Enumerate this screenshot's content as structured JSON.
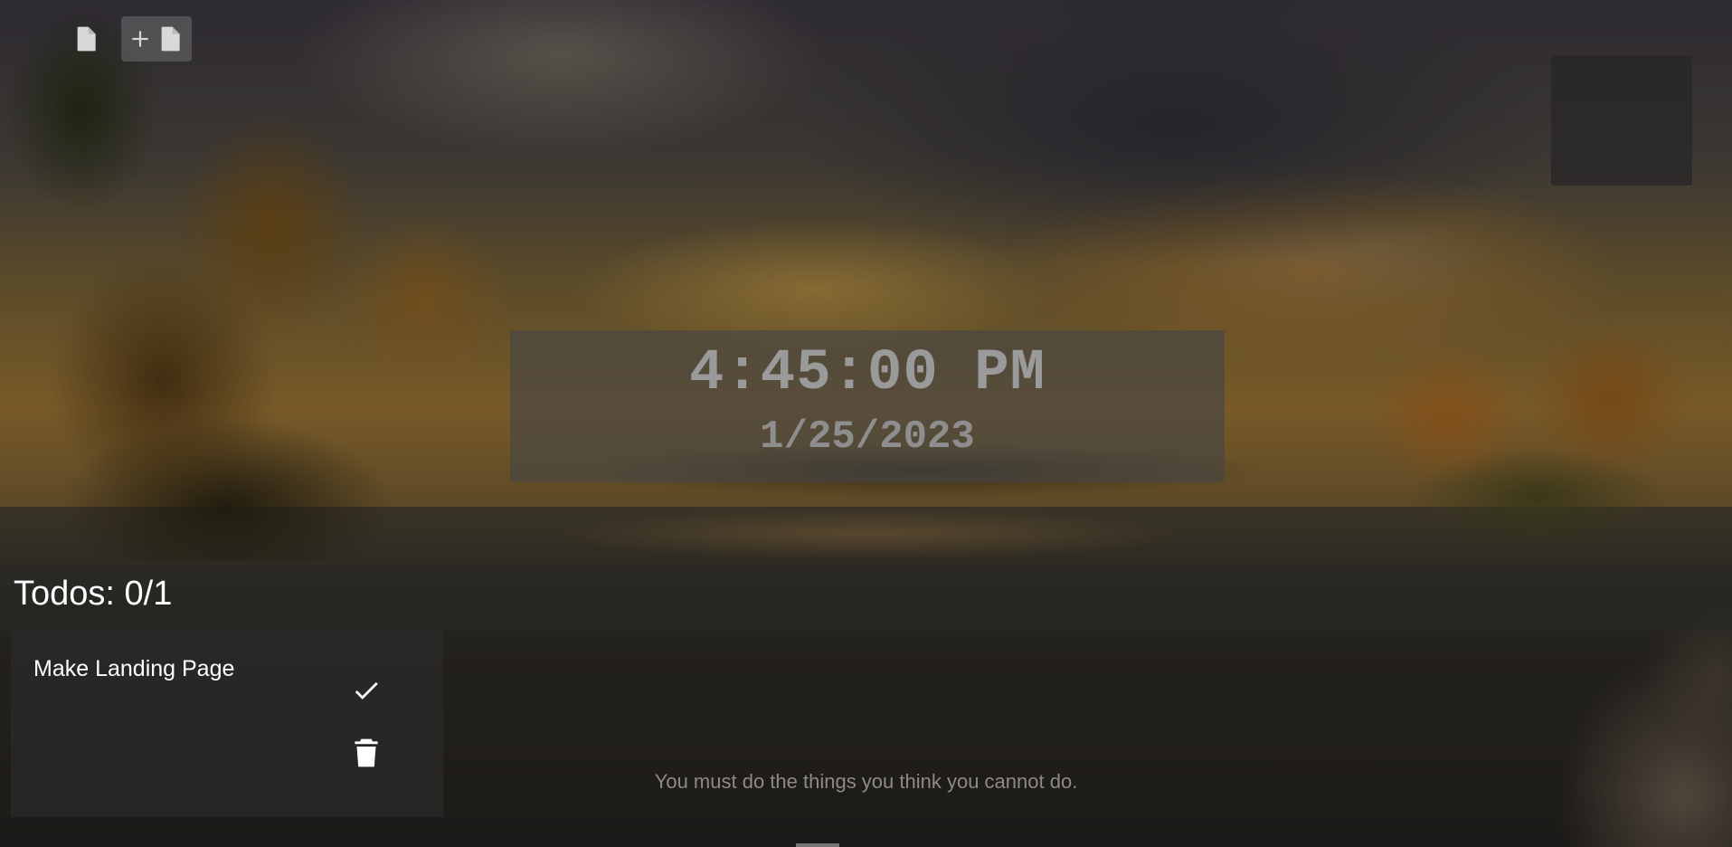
{
  "toolbar": {
    "items": [
      {
        "icon": "document-icon"
      },
      {
        "icon": "add-document-icon"
      }
    ]
  },
  "clock": {
    "time": "4:45:00 PM",
    "date": "1/25/2023"
  },
  "todos": {
    "title": "Todos: 0/1",
    "items": [
      {
        "text": "Make Landing Page",
        "done": false
      }
    ]
  },
  "quote": {
    "text": "You must do the things you think you cannot do."
  },
  "colors": {
    "text": "#ffffff",
    "clock_text": "#9a9a9a",
    "quote_text": "#8d8a86"
  }
}
